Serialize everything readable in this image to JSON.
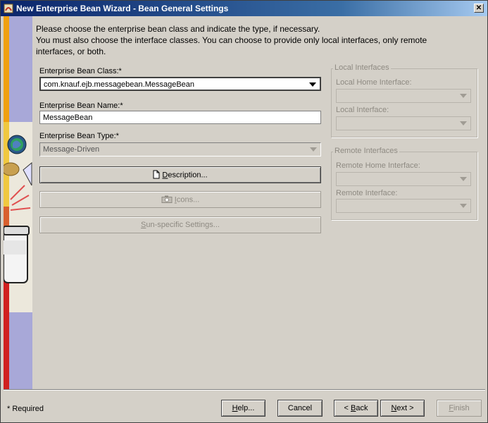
{
  "window": {
    "title": "New Enterprise Bean Wizard - Bean General Settings",
    "close_glyph": "✕"
  },
  "intro": {
    "line1": "Please choose the enterprise bean class and indicate the type, if necessary.",
    "line2": "You must also choose the interface classes.  You can choose to provide only local interfaces, only remote",
    "line3": "interfaces, or both."
  },
  "bean_class": {
    "label": "Enterprise Bean Class:*",
    "value": "com.knauf.ejb.messagebean.MessageBean"
  },
  "bean_name": {
    "label": "Enterprise Bean Name:*",
    "value": "MessageBean"
  },
  "bean_type": {
    "label": "Enterprise Bean Type:*",
    "value": "Message-Driven"
  },
  "buttons": {
    "description": {
      "u": "D",
      "rest": "escription..."
    },
    "icons": {
      "u": "I",
      "rest": "cons..."
    },
    "sun": {
      "u": "S",
      "rest": "un-specific Settings..."
    }
  },
  "local": {
    "title": "Local Interfaces",
    "home_label": "Local Home Interface:",
    "iface_label": "Local Interface:"
  },
  "remote": {
    "title": "Remote Interfaces",
    "home_label": "Remote Home Interface:",
    "iface_label": "Remote Interface:"
  },
  "footer": {
    "required": "* Required",
    "help": {
      "u": "H",
      "rest": "elp..."
    },
    "cancel": "Cancel",
    "back": {
      "pre": "< ",
      "u": "B",
      "rest": "ack"
    },
    "next": {
      "u": "N",
      "rest": "ext >"
    },
    "finish": {
      "u": "F",
      "rest": "inish"
    }
  },
  "icons": {
    "description": "document-icon",
    "icons": "camera-icon",
    "combo_arrow": "chevron-down-icon"
  },
  "colors": {
    "title_bar": "#0a246a",
    "dialog_bg": "#d4d0c8",
    "sidebar_purple": "#9a9acc"
  }
}
